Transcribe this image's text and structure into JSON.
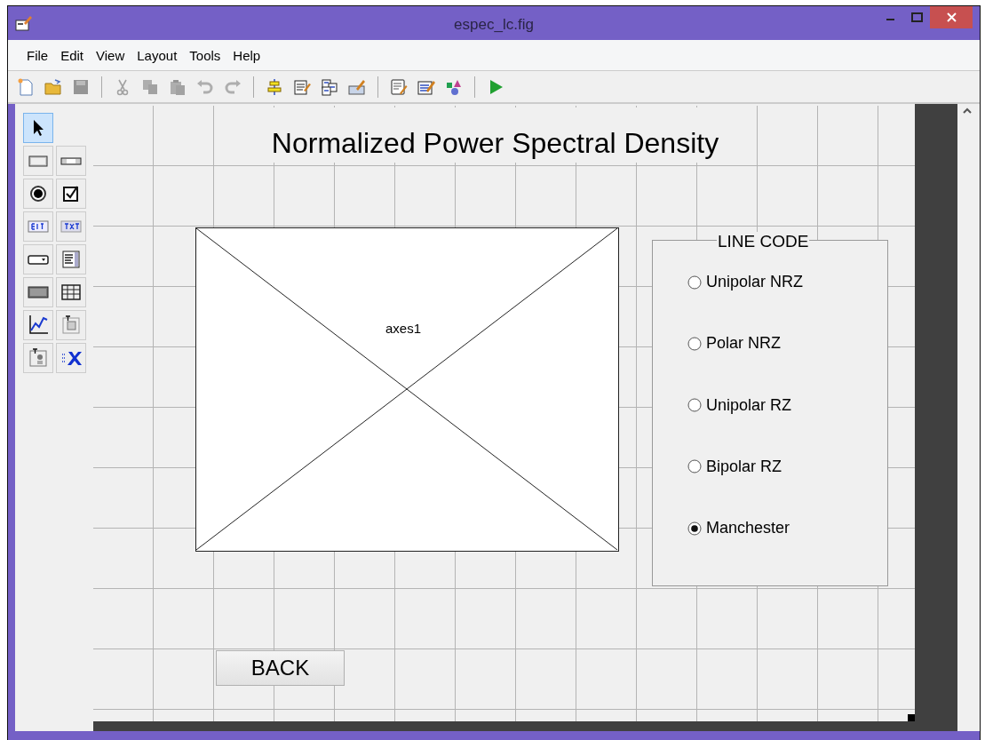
{
  "window": {
    "title": "espec_lc.fig"
  },
  "menu": [
    "File",
    "Edit",
    "View",
    "Layout",
    "Tools",
    "Help"
  ],
  "toolbar": [
    {
      "kind": "new",
      "disabled": false
    },
    {
      "kind": "open",
      "disabled": false
    },
    {
      "kind": "save",
      "disabled": true
    },
    {
      "kind": "sep"
    },
    {
      "kind": "cut",
      "disabled": true
    },
    {
      "kind": "copy",
      "disabled": true
    },
    {
      "kind": "paste",
      "disabled": true
    },
    {
      "kind": "undo",
      "disabled": true
    },
    {
      "kind": "redo",
      "disabled": true
    },
    {
      "kind": "sep"
    },
    {
      "kind": "align",
      "disabled": false
    },
    {
      "kind": "menu-editor",
      "disabled": false
    },
    {
      "kind": "tab-order",
      "disabled": false
    },
    {
      "kind": "toolbar-editor",
      "disabled": false
    },
    {
      "kind": "sep"
    },
    {
      "kind": "mfile",
      "disabled": false
    },
    {
      "kind": "inspector",
      "disabled": false
    },
    {
      "kind": "browser",
      "disabled": false
    },
    {
      "kind": "sep"
    },
    {
      "kind": "run",
      "disabled": false
    }
  ],
  "palette": [
    {
      "kind": "pointer",
      "selected": true
    },
    {
      "kind": "push",
      "selected": false
    },
    {
      "kind": "slider",
      "selected": false
    },
    {
      "kind": "radio",
      "selected": false
    },
    {
      "kind": "check",
      "selected": false
    },
    {
      "kind": "edit",
      "selected": false
    },
    {
      "kind": "text",
      "selected": false
    },
    {
      "kind": "popup",
      "selected": false
    },
    {
      "kind": "listbox",
      "selected": false
    },
    {
      "kind": "toggle",
      "selected": false
    },
    {
      "kind": "table",
      "selected": false
    },
    {
      "kind": "axes",
      "selected": false
    },
    {
      "kind": "panel",
      "selected": false
    },
    {
      "kind": "group",
      "selected": false
    },
    {
      "kind": "activex",
      "selected": false
    }
  ],
  "canvas": {
    "heading": "Normalized Power Spectral Density",
    "axes": {
      "label": "axes1"
    },
    "button_group": {
      "title": "LINE CODE",
      "options": [
        {
          "label": "Unipolar NRZ",
          "selected": false
        },
        {
          "label": "Polar NRZ",
          "selected": false
        },
        {
          "label": "Unipolar RZ",
          "selected": false
        },
        {
          "label": "Bipolar RZ",
          "selected": false
        },
        {
          "label": "Manchester",
          "selected": true
        }
      ]
    },
    "button": {
      "label": "BACK"
    }
  }
}
